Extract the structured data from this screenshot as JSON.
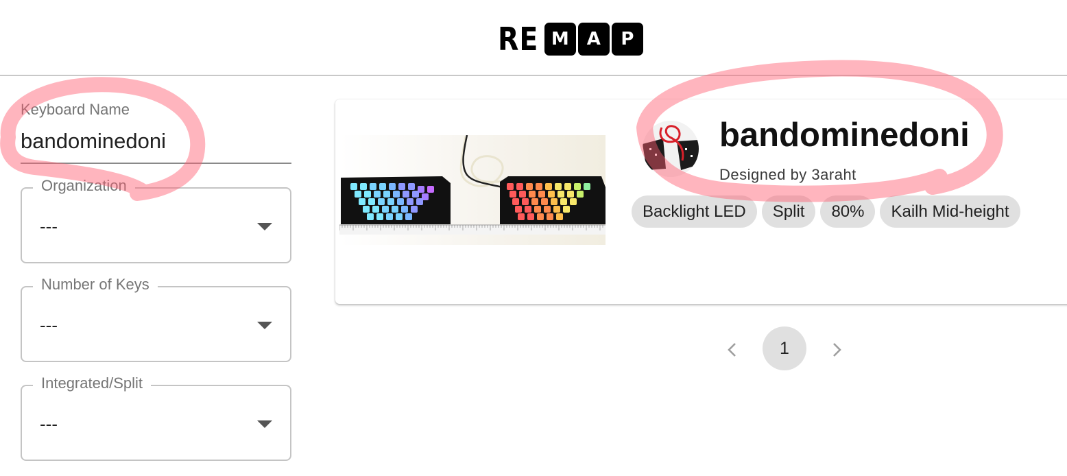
{
  "logo": {
    "prefix": "RE",
    "boxed": [
      "M",
      "A",
      "P"
    ]
  },
  "sidebar": {
    "keyboard_name": {
      "label": "Keyboard Name",
      "value": "bandominedoni"
    },
    "filters": [
      {
        "label": "Organization",
        "value": "---"
      },
      {
        "label": "Number of Keys",
        "value": "---"
      },
      {
        "label": "Integrated/Split",
        "value": "---"
      }
    ]
  },
  "results": [
    {
      "name": "bandominedoni",
      "designer": "Designed by 3araht",
      "tags": [
        "Backlight LED",
        "Split",
        "80%",
        "Kailh Mid-height"
      ]
    }
  ],
  "pagination": {
    "current_page": "1"
  },
  "icons": {
    "prev": "chevron-left-icon",
    "next": "chevron-right-icon",
    "dropdown": "caret-down-icon"
  },
  "colors": {
    "annotation": "#ff6b7a",
    "chip_bg": "#e0e0e0",
    "border": "#c4c4c4"
  }
}
